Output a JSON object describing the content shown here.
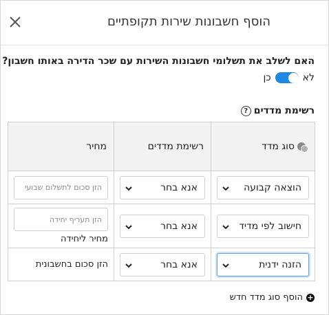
{
  "dialog": {
    "title": "הוסף חשבונות שירות תקופתיים"
  },
  "combine_question": {
    "text": "האם לשלב את תשלומי חשבונות השירות עם שכר הדירה באותו חשבון?",
    "yes_label": "כן",
    "no_label": "לא",
    "toggle_on": true,
    "accent_color": "#1e88e5"
  },
  "meters": {
    "section_label": "רשימת מדדים",
    "columns": {
      "type": "סוג מדד",
      "list": "רשימת מדדים",
      "price": "מחיר"
    },
    "rows": [
      {
        "type_value": "הוצאה קבועה",
        "list_value": "אנא בחר",
        "price_placeholder": "הזן סכום לתשלום שבועי",
        "price_note": ""
      },
      {
        "type_value": "חישוב לפי מדיד",
        "list_value": "אנא בחר",
        "price_placeholder": "הזן תעריף יחידה",
        "price_note": "מחיר ליחידה"
      },
      {
        "type_value": "הזנה ידנית",
        "list_value": "אנא בחר",
        "price_text": "הזן סכום בחשבונית"
      }
    ],
    "add_label": "הוסף סוג מדד חדש"
  },
  "icons": {
    "close": "close-icon",
    "help": "help-icon",
    "coins": "coins-icon",
    "chevron": "chevron-down-icon",
    "plus": "plus-circle-icon"
  }
}
